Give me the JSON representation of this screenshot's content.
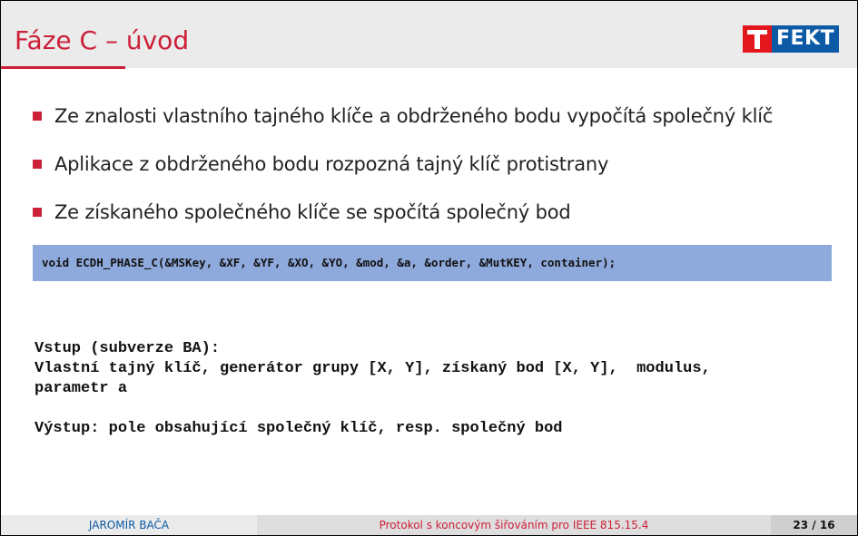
{
  "slide": {
    "title": "Fáze C – úvod",
    "logo": {
      "text": "FEKT",
      "mark": "T",
      "colors": {
        "mark_bg": "#e3161d",
        "word_bg": "#0c5aa6"
      }
    },
    "bullets": [
      "Ze znalosti vlastního tajného klíče a obdrženého bodu vypočítá společný klíč",
      "Aplikace z obdrženého bodu rozpozná tajný klíč protistrany",
      "Ze získaného společného klíče se spočítá společný bod"
    ],
    "code": "void ECDH_PHASE_C(&MSKey, &XF, &YF, &XO, &YO, &mod, &a, &order, &MutKEY, container);",
    "io": {
      "input_heading": "Vstup (subverze BA):",
      "input_line1": "Vlastní tajný klíč, generátor grupy [X, Y], získaný bod [X, Y],  modulus,",
      "input_line2": "parametr a",
      "output_line": "Výstup: pole obsahující společný klíč, resp. společný bod"
    },
    "footer": {
      "author": "JAROMÍR BAČA",
      "talk_title": "Protokol s koncovým šiřováním pro IEEE 815.15.4",
      "page": "23 / 16"
    },
    "colors": {
      "accent_red": "#cc1f38",
      "accent_blue": "#0c5aa6",
      "code_bg": "#8ea9db",
      "header_bg": "#ebebeb"
    }
  }
}
